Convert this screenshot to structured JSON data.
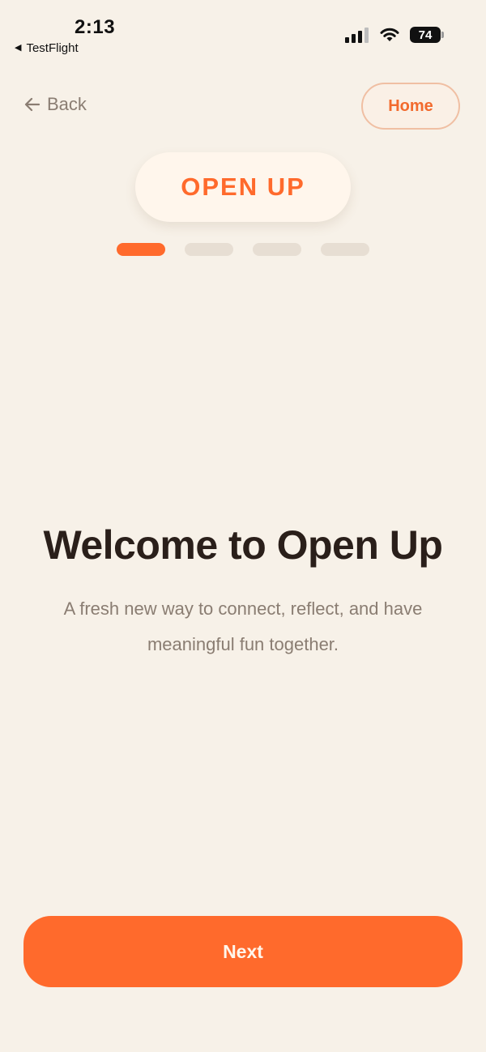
{
  "status_bar": {
    "time": "2:13",
    "back_app": "TestFlight",
    "battery": "74"
  },
  "nav": {
    "back_label": "Back",
    "home_label": "Home"
  },
  "logo": {
    "text": "OPEN UP"
  },
  "progress": {
    "current_step": 1,
    "total_steps": 4
  },
  "main": {
    "title": "Welcome to Open Up",
    "subtitle": "A fresh new way to connect, reflect, and have meaningful fun together."
  },
  "footer": {
    "next_label": "Next"
  },
  "colors": {
    "background": "#F7F1E8",
    "accent": "#FF6A2C",
    "text_dark": "#2A1F1A",
    "text_muted": "#8A7D72"
  },
  "icons": {
    "back": "arrow-left-icon",
    "signal": "cellular-signal-icon",
    "wifi": "wifi-icon",
    "battery": "battery-icon"
  }
}
